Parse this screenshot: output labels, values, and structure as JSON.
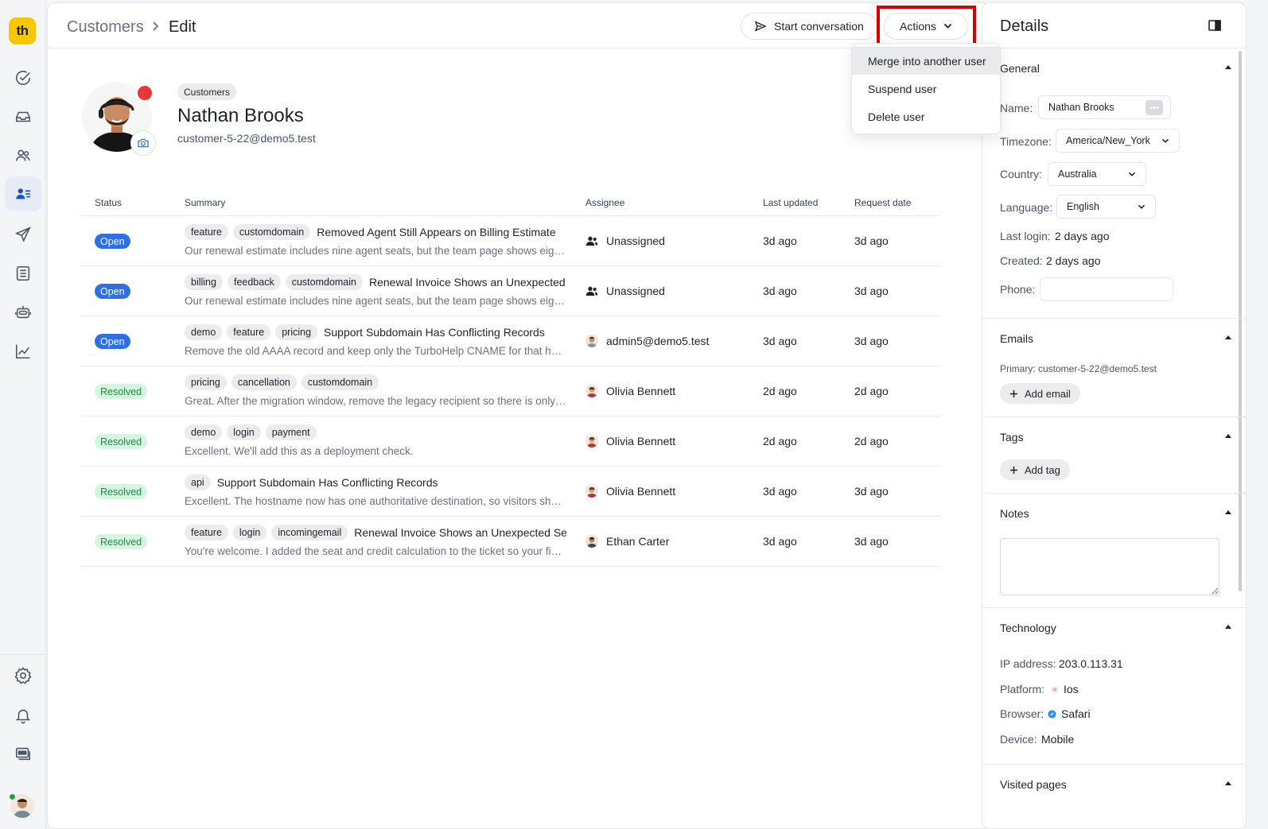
{
  "app": {
    "logo_text": "th"
  },
  "rail": {
    "items": [
      "check-circle-icon",
      "inbox-icon",
      "users-icon",
      "customers-icon",
      "send-icon",
      "list-icon",
      "bot-icon",
      "chart-icon"
    ],
    "bottom": [
      "settings-icon",
      "bell-icon",
      "card-icon"
    ]
  },
  "breadcrumb": {
    "parent": "Customers",
    "current": "Edit"
  },
  "toolbar": {
    "start_label": "Start conversation",
    "actions_label": "Actions"
  },
  "actions_menu": {
    "items": [
      "Merge into another user",
      "Suspend user",
      "Delete user"
    ]
  },
  "profile": {
    "chip": "Customers",
    "name": "Nathan Brooks",
    "email": "customer-5-22@demo5.test"
  },
  "table": {
    "headers": {
      "status": "Status",
      "summary": "Summary",
      "assignee": "Assignee",
      "updated": "Last updated",
      "requested": "Request date"
    },
    "rows": [
      {
        "status": "Open",
        "tags": [
          "feature",
          "customdomain"
        ],
        "subject": "Removed Agent Still Appears on Billing Estimate",
        "preview": "Our renewal estimate includes nine agent seats, but the team page shows eight active agents and one deactivated agent.",
        "assignee": "Unassigned",
        "updated": "3d ago",
        "requested": "3d ago"
      },
      {
        "status": "Open",
        "tags": [
          "billing",
          "feedback",
          "customdomain"
        ],
        "subject": "Renewal Invoice Shows an Unexpected Seat Charge",
        "preview": "Our renewal estimate includes nine agent seats, but the team page shows eight active agents and one deactivated agent.",
        "assignee": "Unassigned",
        "updated": "3d ago",
        "requested": "3d ago"
      },
      {
        "status": "Open",
        "tags": [
          "demo",
          "feature",
          "pricing"
        ],
        "subject": "Support Subdomain Has Conflicting Records",
        "preview": "Remove the old AAAA record and keep only the TurboHelp CNAME for that hostname.",
        "assignee": "admin5@demo5.test",
        "updated": "3d ago",
        "requested": "3d ago"
      },
      {
        "status": "Resolved",
        "tags": [
          "pricing",
          "cancellation",
          "customdomain"
        ],
        "subject": "",
        "preview": "Great. After the migration window, remove the legacy recipient so there is only one destination.",
        "assignee": "Olivia Bennett",
        "updated": "2d ago",
        "requested": "2d ago"
      },
      {
        "status": "Resolved",
        "tags": [
          "demo",
          "login",
          "payment"
        ],
        "subject": "",
        "preview": "Excellent. We'll add this as a deployment check.",
        "assignee": "Olivia Bennett",
        "updated": "2d ago",
        "requested": "2d ago"
      },
      {
        "status": "Resolved",
        "tags": [
          "api"
        ],
        "subject": "Support Subdomain Has Conflicting Records",
        "preview": "Excellent. The hostname now has one authoritative destination, so visitors should reach the portal.",
        "assignee": "Olivia Bennett",
        "updated": "3d ago",
        "requested": "3d ago"
      },
      {
        "status": "Resolved",
        "tags": [
          "feature",
          "login",
          "incomingemail"
        ],
        "subject": "Renewal Invoice Shows an Unexpected Seat Charge",
        "preview": "You're welcome. I added the seat and credit calculation to the ticket so your finance team can review it.",
        "assignee": "Ethan Carter",
        "updated": "3d ago",
        "requested": "3d ago"
      }
    ]
  },
  "details": {
    "title": "Details",
    "general": {
      "title": "General",
      "name_label": "Name:",
      "name_value": "Nathan Brooks",
      "timezone_label": "Timezone:",
      "timezone_value": "America/New_York",
      "country_label": "Country:",
      "country_value": "Australia",
      "language_label": "Language:",
      "language_value": "English",
      "last_login_label": "Last login:",
      "last_login_value": "2 days ago",
      "created_label": "Created:",
      "created_value": "2 days ago",
      "phone_label": "Phone:"
    },
    "emails": {
      "title": "Emails",
      "primary": "Primary: customer-5-22@demo5.test",
      "add_label": "Add email"
    },
    "tags": {
      "title": "Tags",
      "add_label": "Add tag"
    },
    "notes": {
      "title": "Notes"
    },
    "technology": {
      "title": "Technology",
      "ip_label": "IP address:",
      "ip_value": "203.0.113.31",
      "platform_label": "Platform:",
      "platform_value": "Ios",
      "browser_label": "Browser:",
      "browser_value": "Safari",
      "device_label": "Device:",
      "device_value": "Mobile"
    },
    "visited": {
      "title": "Visited pages"
    }
  },
  "colors": {
    "accent": "#2f6fe4",
    "brand": "#f7c800",
    "highlight": "#d40000",
    "resolved_bg": "#d5f5e0",
    "resolved_fg": "#1f8a46",
    "presence_red": "#e5383b"
  }
}
